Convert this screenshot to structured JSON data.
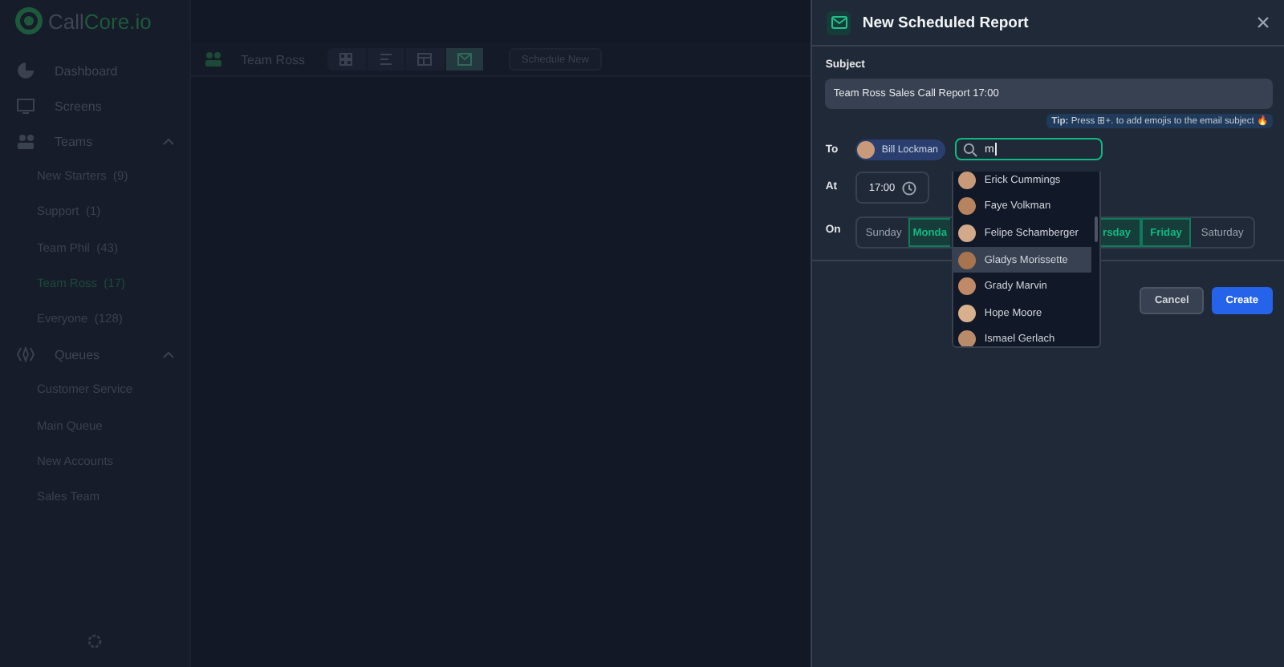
{
  "brand": {
    "name_start": "Call",
    "name_end": "Core.io"
  },
  "sidebar": {
    "items": [
      {
        "kind": "section",
        "label": "Dashboard"
      },
      {
        "kind": "section",
        "label": "Screens"
      },
      {
        "kind": "section",
        "label": "Teams",
        "expanded": true,
        "children": [
          {
            "label": "New Starters",
            "count": "(9)",
            "selected": false
          },
          {
            "label": "Support",
            "count": "(1)",
            "selected": false
          },
          {
            "label": "Team Phil",
            "count": "(43)",
            "selected": false
          },
          {
            "label": "Team Ross",
            "count": "(17)",
            "selected": true
          },
          {
            "label": "Everyone",
            "count": "(128)",
            "selected": false
          }
        ]
      },
      {
        "kind": "section",
        "label": "Queues",
        "expanded": true,
        "children": [
          {
            "label": "Customer Service",
            "selected": false
          },
          {
            "label": "Main Queue",
            "selected": false
          },
          {
            "label": "New Accounts",
            "selected": false
          },
          {
            "label": "Sales Team",
            "selected": false
          }
        ]
      }
    ]
  },
  "header": {
    "title": "Team Ross",
    "views": [
      {
        "selected": false
      },
      {
        "selected": false
      },
      {
        "selected": false
      },
      {
        "selected": true
      }
    ],
    "action": "Schedule New"
  },
  "dialog": {
    "title": "New Scheduled Report",
    "subject_label": "Subject",
    "subject_value": "Team Ross Sales Call Report 17:00",
    "tip": "**Tip:** Press ⊞+. to add emojis to the email subject 🔥",
    "to_label": "To",
    "recipients": [
      {
        "name": "Bill Lockman"
      }
    ],
    "search_value": "m",
    "at_label": "At",
    "time": "17:00",
    "on_label": "On",
    "days": [
      {
        "label": "Sunday",
        "selected": false
      },
      {
        "label": "Monda",
        "selected": true
      },
      {
        "label": "rsday",
        "selected": true
      },
      {
        "label": "Friday",
        "selected": true
      },
      {
        "label": "Saturday",
        "selected": false
      }
    ],
    "suggestions": [
      {
        "name": "Erick Cummings",
        "selected": false
      },
      {
        "name": "Faye Volkman",
        "selected": false
      },
      {
        "name": "Felipe Schamberger",
        "selected": false
      },
      {
        "name": "Gladys Morissette",
        "selected": true
      },
      {
        "name": "Grady Marvin",
        "selected": false
      },
      {
        "name": "Hope Moore",
        "selected": false
      },
      {
        "name": "Ismael Gerlach",
        "selected": false
      }
    ],
    "cancel": "Cancel",
    "create": "Create"
  }
}
